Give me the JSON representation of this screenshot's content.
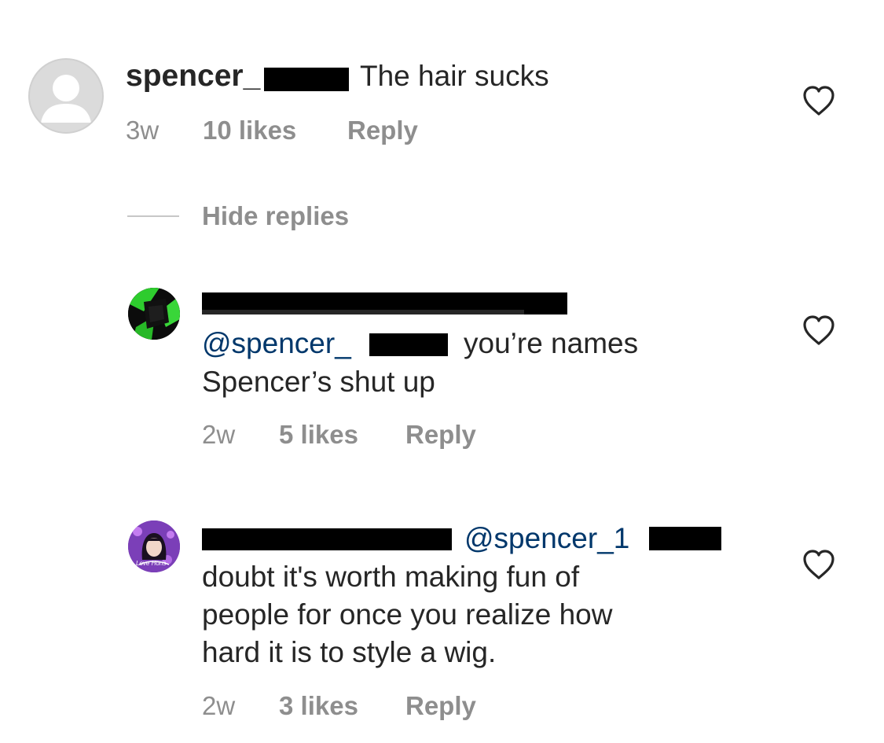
{
  "comments": [
    {
      "username": "spencer_",
      "text": "The hair sucks",
      "time": "3w",
      "likes": "10 likes",
      "reply_label": "Reply"
    }
  ],
  "hide_replies_label": "Hide replies",
  "replies": [
    {
      "mention": "@spencer_",
      "text_line1": "you’re names",
      "text_line2": "Spencer’s shut up",
      "time": "2w",
      "likes": "5 likes",
      "reply_label": "Reply"
    },
    {
      "mention": "@spencer_1",
      "text_line1": "doubt it's worth making fun of",
      "text_line2": "people for once you realize how",
      "text_line3": "hard it is to style a wig.",
      "time": "2w",
      "likes": "3 likes",
      "reply_label": "Reply",
      "avatar_badge": "Love Horis"
    }
  ],
  "colors": {
    "text": "#262626",
    "secondary": "#8e8e8e",
    "mention": "#00376b",
    "redaction": "#000000"
  },
  "icons": {
    "like": "heart-outline-icon",
    "default_avatar": "default-avatar-icon"
  }
}
